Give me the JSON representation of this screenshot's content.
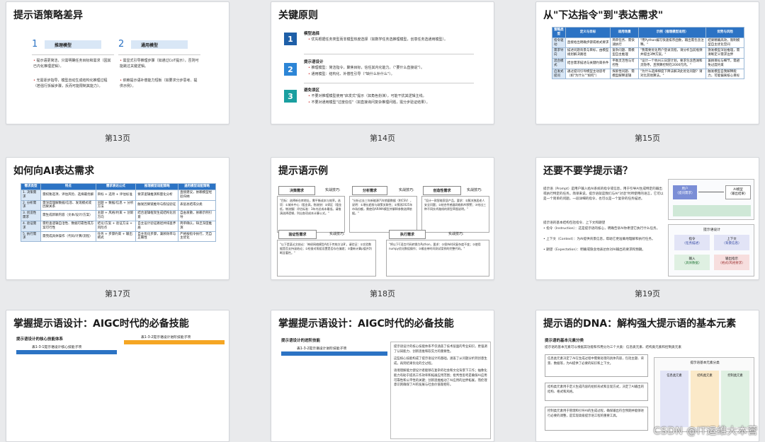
{
  "slides": [
    {
      "id": "p13",
      "title": "提示语策略差异",
      "caption": "第13页",
      "left_num": "1",
      "left_label": "推理模型",
      "right_num": "2",
      "right_label": "通用模型",
      "left_bullets": [
        "提示语更简洁，只需明确任务目标和需求（因其已内化推理逻辑）。",
        "无需逐步指导，模型自动生成结构化推理过程（若强行拆解步骤，反而可能限制其能力）。"
      ],
      "right_bullets": [
        "需显式引导推理步骤（如通过CoT提示），否则可能跳过关键逻辑。",
        "依赖提示语补偿能力短板（如要求分步思考、提供示例）。"
      ]
    },
    {
      "id": "p14",
      "title": "关键原则",
      "caption": "第14页",
      "sections": [
        {
          "num": "1",
          "head": "模型选择",
          "lines": [
            "优先根据任务类型而非模型热度选择（如数学任务选推理模型，创意任务选通用模型）。"
          ]
        },
        {
          "num": "2",
          "head": "提示语设计",
          "lines": [
            "推理模型：简洁指令，聚焦目标，信任其内化能力。（\"要什么直接说\"）。",
            "通用模型：结构化、补偿性引导（\"缺什么补什么\"）。"
          ]
        },
        {
          "num": "3",
          "head": "避免误区",
          "lines": [
            "不要对推理模型使用\"启发式\"提示（如角色扮演），可能干扰其逻辑主线。",
            "不要对通用模型\"过度信任\"（如直接询问复杂推理问题，需分步验证结果）。"
          ]
        }
      ]
    },
    {
      "id": "p15",
      "title": "从\"下达指令\"到\"表达需求\"",
      "caption": "第15页",
      "headers": [
        "策略类型",
        "定义与目标",
        "适用场景",
        "示例（推理模型适用）",
        "优势与风险"
      ],
      "rows": [
        [
          "指令驱动",
          "直接给出明确步骤或格式要求",
          "简单任务、需快速执行",
          "\"用Python编写快速排序函数，输出需包含注释。\"",
          "结果精确高效，限制模型自主优化空间"
        ],
        [
          "需求导向",
          "描述问题背景与目标，由模型规划解决路径",
          "复杂问题、需模型自主推理",
          "\"我需要优化用户登录流程，请分析当前瓶颈并提出3种方案。\"",
          "激发模型深层推理，需清晰定义需求边界"
        ],
        [
          "混合模式",
          "结合需求描述与关键约束条件",
          "平衡灵活性与可控性",
          "\"设计一个杭州三日游计划，要求包含西湖和灵隐寺，且预算控制在2000元内。\"",
          "兼顾目标与细节，需避免过度约束"
        ],
        [
          "启发式提问",
          "通过提问引导模型主动思考（如\"为什么\"\"如何\"）",
          "探索性问题、需模型解释逻辑",
          "\"为什么选择梯度下降法解决此优化问题？请对比其他算法。\"",
          "触发模型自我解释能力，可能偏离核心目标"
        ]
      ]
    },
    {
      "id": "p17",
      "title": "如何向AI表达需求",
      "caption": "第17页",
      "headers": [
        "需求类型",
        "特点",
        "需求表达公式",
        "推理模型适配策略",
        "通用模型适配策略"
      ],
      "rows": [
        [
          "1. 决策需求",
          "需权衡选项、评估风险、选择最优解",
          "目标 + 选项 + 评估标准",
          "要求逻辑推演和量化分析",
          "直接建议，依赖模型经验归纳"
        ],
        [
          "2. 分析需求",
          "需深度理解数据/信息、发现模式或因果关系",
          "问题 + 数据/信息 + 分析方法",
          "触发因果链推导与假设验证",
          "表层总结或分类"
        ],
        [
          "3. 创造性需求",
          "需生成新颖内容（文本/设计/方案）",
          "主题 + 风格/约束 + 创新方向",
          "结合逻辑框架生成结构化创意",
          "自由发散，依赖示例引导"
        ],
        [
          "4. 验证需求",
          "需检查逻辑自洽性、数据可靠性或方案可行性",
          "结论/方案 + 验证方法 + 风险点",
          "自主设计验证路径并排查矛盾",
          "简单确认，缺乏深度推演"
        ],
        [
          "5. 执行需求",
          "需完成具体操作（代码/计算/流程）",
          "任务 + 步骤约束 + 输出格式",
          "自主优化步骤，兼顾效率与正确性",
          "严格按指令执行，无自主优化"
        ]
      ]
    },
    {
      "id": "p18",
      "title": "提示语示例",
      "caption": "第18页",
      "boxes": [
        {
          "label": "决策需求",
          "hint": "实战技巧:",
          "text": "\"目标：选择新仓库地址，需平衡成本与效率。选项：①城市中心（租金高，物流快）②郊区（租金低，物流慢）评估标准：3年内总成本最低。请推演选择逻辑，列出各项成本计算公式。\""
        },
        {
          "label": "分析需求",
          "hint": "实战技巧:",
          "text": "\"分析过去三年新能源汽车销量数据（附CSV），说明：①增长趋势与政策关联性；②预测2025年市场份额，需使用ARIMA模型并解释参数选择依据。\""
        },
        {
          "label": "创造性需求",
          "hint": "实战技巧:",
          "text": "\"设计一款智能家居产品，要求：①解决独居老人安全问题；②结合传感器网络和AI预警；③给出三种不同技术路线的原型草图说明。\""
        },
        {
          "label": "验证性需求",
          "hint": "实战技巧:",
          "text": "\"以下是某论文结论：'神经网络模型A优于传统方法B'。请验证：①实验数据是否支持该结论；②检查对照组设置是否存在偏差；③重新计算p值并判断显著性。\""
        },
        {
          "label": "执行需求",
          "hint": "实战技巧:",
          "text": "\"将以下C语言代码转换为Python，要求：①保持时间复杂度不变；②使用numpy优化数组操作；③输出带时间测试案例的完整代码。\""
        }
      ]
    },
    {
      "id": "p19",
      "title": "还要不要学提示语？",
      "caption": "第19页",
      "paragraphs": [
        "提示语（Prompt）是用户输入给AI系统的指令或信息，用于引导AI生成特定的输出或执行特定的任务。简单来说，提示语就是我们与AI\"对话\"时所使用的语言，它可以是一个简单的问题，一段详细的指令，也可以是一个复杂的任务描述。",
        "提示语的基本结构包括指令、上下文和期望",
        "• 指令（Instruction）：这是提示语的核心，明确告诉AI你希望它执行什么任务。",
        "• 上下文（Context）：为AI提供背景信息，帮助它更准确地理解和执行任务。",
        "• 期望（Expectation）：明确或隐含地表达你对AI输出的要求和预期。"
      ],
      "diagram": {
        "user": "用户",
        "user_sub": "（提问需求）",
        "ai": "AI模型",
        "ai_sub": "（输出结果）",
        "prompt_box": "提示语设计",
        "cells": [
          "指令",
          "上下文",
          "输入",
          "输出指示"
        ],
        "cell_subs": [
          "（任务描述）",
          "（背景信息）",
          "（具体数据）",
          "（格式/风格要求）"
        ]
      }
    },
    {
      "id": "p20",
      "title": "掌握提示语设计：AIGC时代的必备技能",
      "caption": "",
      "subtitle": "提示语设计的核心技能体系",
      "table1_title": "表1-3-1提示语设计核心技能子项",
      "table2_title": "表1-3-2提示语设计进阶技能子项"
    },
    {
      "id": "p21",
      "title": "掌握提示语设计：AIGC时代的必备技能",
      "caption": "",
      "subtitle": "提示语设计的进阶技能",
      "table_title": "表1-3-2提示语设计进阶技能子项",
      "paragraphs": [
        "提示语设计的核心技能体系不仅涵盖了技术层面的专业知识，更强调了认知能力、创新思维和软实力的重要性。",
        "这些核心技能构成了提示语设计的基础，涵盖了从问题分析到创意生成，再到结果优化的全过程。",
        "语境理解能力使设计者能够在复杂的社会和文化背景下工作；抽象化能力有助于提高工作效率和拓展应用范围；批判性思考是确保AI应用可靠性和公平性的关键；创新思维推动了AI应用的边界拓展，而伦理意识则确保了AI的发展与社会价值观相符。"
      ]
    },
    {
      "id": "p22",
      "title": "提示语的DNA：解构强大提示语的基本元素",
      "caption": "",
      "subtitle": "提示语的基本元素分类",
      "intro": "提示语的基本元素可以根据其功能和作用分为三个大类：信息类元素、结构类元素和控制类元素",
      "paragraphs": [
        "信息类元素决定了AI在生成过程中需要处理的具体内容，包括主题、背景、数据等，为AI提供了必要的知识和上下文。",
        "结构类元素用于定义生成内容的组织形式和呈现方式，决定了AI输出的结构、格式和风格。",
        "控制类元素用于管理和引导AI的生成过程，确保输出符合预期并能够进行必要的调整，是实现高级提示语工程的重要工具。"
      ],
      "diagram_title": "提示语基本元素分类",
      "diagram_cols": [
        "信息类元素",
        "结构类元素",
        "控制类元素"
      ]
    }
  ],
  "watermark": "CSDN @IT运维大本营",
  "colors": {
    "accent_blue": "#2c73c4",
    "dark_blue": "#1e5fa8",
    "teal": "#1a9fa0",
    "light_blue": "#d9e7f6"
  }
}
